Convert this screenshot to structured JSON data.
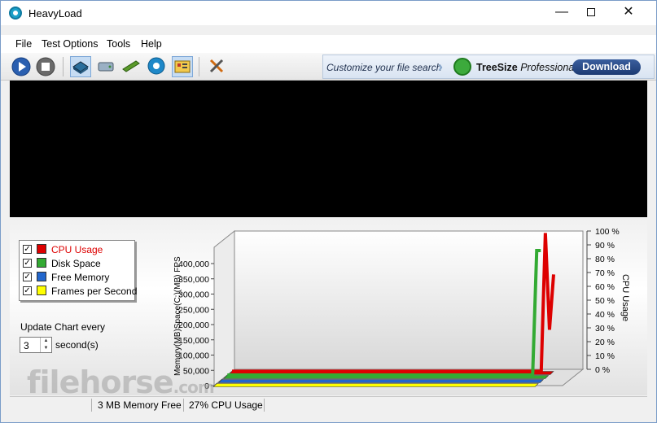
{
  "window": {
    "title": "HeavyLoad"
  },
  "menu": [
    "File",
    "Test Options",
    "Tools",
    "Help"
  ],
  "ad": {
    "prompt": "Customize your file search",
    "brand_bold": "TreeSize",
    "brand_italic": "Professional",
    "button": "Download"
  },
  "legend": [
    {
      "label": "CPU Usage",
      "color": "#dd0000",
      "checked": true,
      "highlight": true
    },
    {
      "label": "Disk Space",
      "color": "#33aa33",
      "checked": true,
      "highlight": false
    },
    {
      "label": "Free Memory",
      "color": "#2266cc",
      "checked": true,
      "highlight": false
    },
    {
      "label": "Frames per Second",
      "color": "#ffff00",
      "checked": true,
      "highlight": false
    }
  ],
  "update": {
    "label": "Update Chart every",
    "value": "3",
    "unit": "second(s)"
  },
  "chart_data": {
    "type": "area",
    "left_axis_label": "Memory(MB)Space(C:)(MB) FPS",
    "right_axis_label": "CPU Usage",
    "left_ticks": [
      "0",
      "50,000",
      "100,000",
      "150,000",
      "200,000",
      "250,000",
      "300,000",
      "350,000",
      "400,000"
    ],
    "right_ticks": [
      "0 %",
      "10 %",
      "20 %",
      "30 %",
      "40 %",
      "50 %",
      "60 %",
      "70 %",
      "80 %",
      "90 %",
      "100 %"
    ],
    "left_ylim": [
      0,
      400000
    ],
    "right_ylim": [
      0,
      100
    ],
    "series": [
      {
        "name": "CPU Usage",
        "color": "#dd0000",
        "values": [
          0,
          0,
          0,
          0,
          0,
          0,
          0,
          0,
          0,
          0,
          0,
          0,
          0,
          0,
          0,
          0,
          0,
          0,
          0,
          0,
          0,
          0,
          0,
          0,
          0,
          0,
          0,
          0,
          0,
          0,
          0,
          0,
          0,
          0,
          0,
          0,
          0,
          0,
          0,
          0,
          0,
          0,
          0,
          0,
          0,
          0,
          0,
          0,
          0,
          0,
          0,
          0,
          0,
          0,
          0,
          0,
          0,
          0,
          0,
          0,
          0,
          0,
          0,
          0,
          0,
          0,
          0,
          0,
          0,
          0,
          0,
          0,
          0,
          0,
          0,
          0,
          100,
          30,
          70
        ]
      },
      {
        "name": "Disk Space",
        "color": "#33aa33",
        "values": [
          0,
          0,
          0,
          0,
          0,
          0,
          0,
          0,
          0,
          0,
          0,
          0,
          0,
          0,
          0,
          0,
          0,
          0,
          0,
          0,
          0,
          0,
          0,
          0,
          0,
          0,
          0,
          0,
          0,
          0,
          0,
          0,
          0,
          0,
          0,
          0,
          0,
          0,
          0,
          0,
          0,
          0,
          0,
          0,
          0,
          0,
          0,
          0,
          0,
          0,
          0,
          0,
          0,
          0,
          0,
          0,
          0,
          0,
          0,
          0,
          0,
          0,
          0,
          0,
          0,
          0,
          0,
          0,
          0,
          0,
          0,
          0,
          0,
          0,
          0,
          0,
          90,
          90
        ]
      },
      {
        "name": "Free Memory",
        "color": "#2266cc",
        "values": [
          0
        ]
      },
      {
        "name": "Frames per Second",
        "color": "#ffff00",
        "values": [
          0
        ]
      }
    ]
  },
  "status": {
    "memory": "3 MB Memory Free",
    "cpu": "27% CPU Usage"
  },
  "watermark": {
    "name": "filehorse",
    "suffix": ".com"
  }
}
